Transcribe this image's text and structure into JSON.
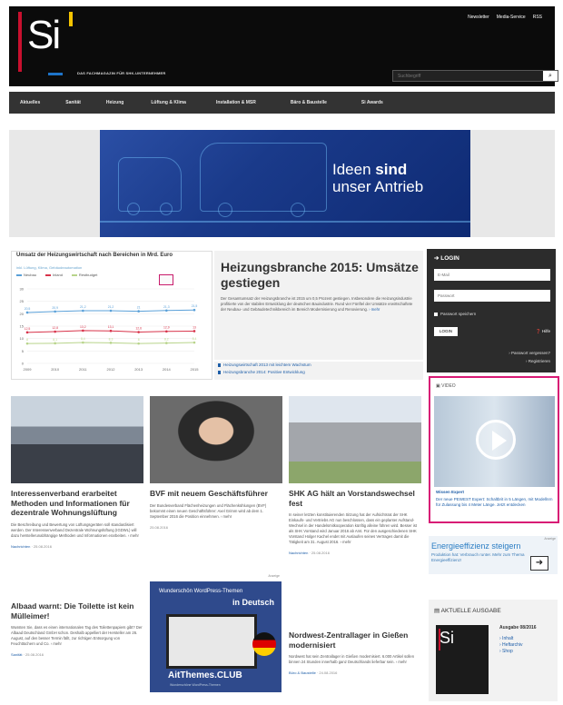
{
  "header": {
    "logo_text": "Si",
    "tagline": "DAS FACHMAGAZIN FÜR SHK-UNTERNEHMER",
    "top_links": [
      "Newsletter",
      "Media-Service",
      "RSS"
    ],
    "search_placeholder": "Suchbegriff"
  },
  "nav": {
    "items": [
      "Aktuelles",
      "Sanität",
      "Heizung",
      "Lüftung & Klima",
      "Installation & MSR",
      "Bäro & Baustelle",
      "Si Awards"
    ]
  },
  "banner": {
    "line1": "Ideen",
    "line1b": "sind",
    "line2": "unser Antrieb"
  },
  "chart_data": {
    "type": "line",
    "title": "Umsatz der Heizungswirtschaft nach Bereichen in Mrd. Euro",
    "subtitle": "inkl. Lüftung, Klima, Gebäudeautomation",
    "categories": [
      "2009",
      "2010",
      "2011",
      "2012",
      "2013",
      "2014",
      "2015"
    ],
    "series": [
      {
        "name": "Neubau",
        "color": "#5aa0d8",
        "values": [
          20.5,
          20.9,
          21.2,
          21.2,
          21.0,
          21.3,
          21.5
        ]
      },
      {
        "name": "Inland",
        "color": "#d8334a",
        "values": [
          12.5,
          12.8,
          13.2,
          13.1,
          12.6,
          12.9,
          13.0
        ]
      },
      {
        "name": "Restbudget",
        "color": "#b8d48b",
        "values": [
          8.0,
          8.1,
          8.4,
          8.3,
          8.0,
          8.2,
          8.4
        ]
      }
    ],
    "ylim": [
      0,
      30
    ],
    "yticks": [
      "0",
      "5",
      "10",
      "15",
      "20",
      "25",
      "30"
    ]
  },
  "main_article": {
    "title": "Heizungsbranche 2015: Umsätze gestiegen",
    "text": "Der Gesamtumsatz der Heizungsbranche ist 2015 um 0,5 Prozent gestiegen. Insbesondere die Heizungsindustrie profitierte von der stabilen Entwicklung der deutschen Bauindustrie. Rund vier Fünftel der Umsätze erwirtschaftete der Neubau- und Gebäudetechnikbereich im Bereich Modernisierung und Renovierung.",
    "more": "› mehr",
    "related": [
      "Heizungswirtschaft 2013 mit leichtem Wachstum",
      "Heizungsbranche 2014: Positive Entwicklung"
    ]
  },
  "login": {
    "title": "LOGIN",
    "email_placeholder": "E-Mail",
    "password_placeholder": "Passwort",
    "remember": "Passwort speichern",
    "button": "LOGIN",
    "help": "❓ Hilfe",
    "forgot": "› Passwort vergessen?",
    "register": "› Registrieren"
  },
  "video": {
    "head": "VIDEO",
    "caption": "Wissen Expert",
    "text": "Der neue PEWEST Expert: Schaltbrit in 5 Längen, mit Modellnrn für Zulassung bis 4 Meter Länge. Jetzt entdecken"
  },
  "energy_ad": {
    "label": "Anzeige",
    "title": "Energieeffizienz steigern",
    "text": "Produktion hat: Verbrauch runter. Mehr zum Thema Energieeffizienz!",
    "arrow": "➜"
  },
  "issue": {
    "head": "AKTUELLE AUSGABE",
    "title": "Ausgabe 08/2016",
    "links": [
      "› Inhalt",
      "› Heftarchiv",
      "› Shop"
    ]
  },
  "articles": [
    {
      "title": "Interessenverband erarbeitet Methoden und Informationen für dezentrale Wohnungslüftung",
      "text": "Die Beschreibung und Bewertung von Lüftungsgeräten soll standardisiert werden. Der Interessenverband Dezentrale Wohnungslüftung (IGDWL) will dazu herstellerunabhängige Methoden und Informationen erarbeiten. › mehr",
      "category": "Nachrichten",
      "date": "25.08.2016"
    },
    {
      "title": "BVF mit neuem Geschäftsführer",
      "text": "Der Bundesverband Flächenheizungen und Flächenkühlungen (BVF) bekommt einen neuen Geschäftsführer: Axel Grimm wird ab dem 1. September 2016 die Position einnehmen. › mehr",
      "category": "",
      "date": "25.08.2016"
    },
    {
      "title": "SHK AG hält an Vorstandswechsel fest",
      "text": "In seiner letzten konstituierenden Sitzung hat der Aufsichtsrat der SHK Einkaufs- und Vertriebs AG nun beschlossen, dass ein geplanter Aufstand-Wechsel in der Handelsmitkooperation künftig alleine führen wird. Besser ist als SHK Vorstand wird Januar 2016 ab Amt. Für den ausgeschiedenen SHK Vorstand Holger Kachel endet mit Auslaufen seines Vertrages damit die Tätigkeit am 31. August 2016. › mehr",
      "category": "Nachrichten",
      "date": "25.08.2016"
    },
    {
      "title": "Albaad warnt: Die Toilette ist kein Mülleimer!",
      "text": "Wussten Sie, dass es einen internationalen Tag des Toilettenpapiers gibt? Der Albaad Deutschland GmbH schon. Deshalb appelliert der Hersteller am 26. August, auf den besser Termin fällt, zur richtigen Entsorgung von Feuchttüchern und Co. › mehr",
      "category": "Sanität",
      "date": "25.08.2016"
    },
    {
      "title": "Nordwest-Zentrallager in Gießen modernisiert",
      "text": "Nordwest hat sein Zentrallager in Gießen modernisiert. 6.000 Artikel sollen binnen 24 Stunden innerhalb ganz Deutschlands lieferbar sein. › mehr",
      "category": "Büro & Baustelle",
      "date": "24.08.2016"
    }
  ],
  "ad_wordpress": {
    "label": "Anzeige",
    "line1": "Wunderschön WordPress-Themen",
    "line2": "in Deutsch",
    "logo": "AitThemes.CLUB",
    "sub": "Wunderschöne WordPress-Themen"
  }
}
